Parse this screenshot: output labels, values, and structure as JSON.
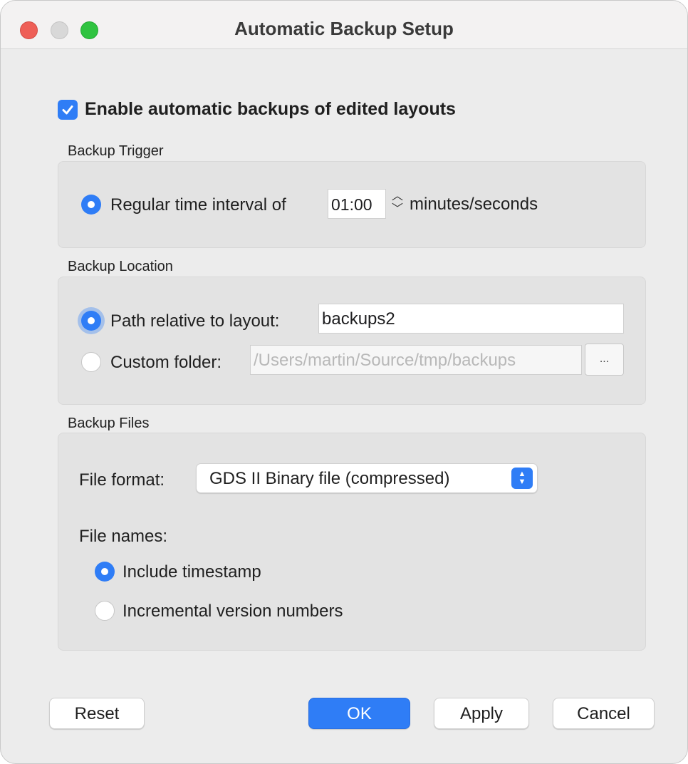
{
  "window": {
    "title": "Automatic Backup Setup"
  },
  "enable_backups": {
    "label": "Enable automatic backups of edited layouts",
    "checked": true
  },
  "backup_trigger": {
    "title": "Backup Trigger",
    "interval_label": "Regular time interval of",
    "interval_value": "01:00",
    "interval_unit": "minutes/seconds"
  },
  "backup_location": {
    "title": "Backup Location",
    "relative_label": "Path relative to layout:",
    "relative_value": "backups2",
    "custom_label": "Custom folder:",
    "custom_value": "/Users/martin/Source/tmp/backups",
    "browse_label": "...",
    "selected": "relative"
  },
  "backup_files": {
    "title": "Backup Files",
    "format_label": "File format:",
    "format_value": "GDS II Binary file (compressed)",
    "names_label": "File names:",
    "timestamp_label": "Include timestamp",
    "incremental_label": "Incremental version numbers",
    "selected": "timestamp"
  },
  "buttons": {
    "reset": "Reset",
    "ok": "OK",
    "apply": "Apply",
    "cancel": "Cancel"
  },
  "colors": {
    "accent": "#2f7df6",
    "close": "#ee5f57",
    "zoom": "#2fc340"
  }
}
